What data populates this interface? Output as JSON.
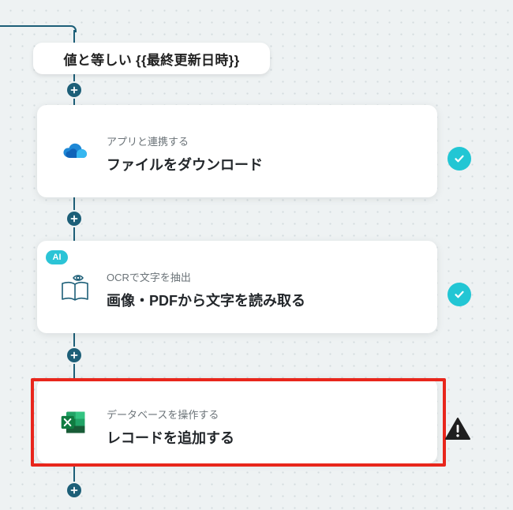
{
  "condition": {
    "label": "値と等しい {{最終更新日時}}"
  },
  "steps": [
    {
      "subtitle": "アプリと連携する",
      "title": "ファイルをダウンロード",
      "icon": "onedrive-icon",
      "status": "success"
    },
    {
      "subtitle": "OCRで文字を抽出",
      "title": "画像・PDFから文字を読み取る",
      "icon": "ocr-book-eye-icon",
      "badge": "AI",
      "status": "success"
    },
    {
      "subtitle": "データベースを操作する",
      "title": "レコードを追加する",
      "icon": "excel-icon",
      "status": "warning",
      "highlighted": true
    }
  ],
  "colors": {
    "connector": "#1d5f78",
    "success": "#22c6d4",
    "ai_badge": "#2bc4d6",
    "highlight": "#e8261c",
    "warning": "#1f1f1f"
  }
}
